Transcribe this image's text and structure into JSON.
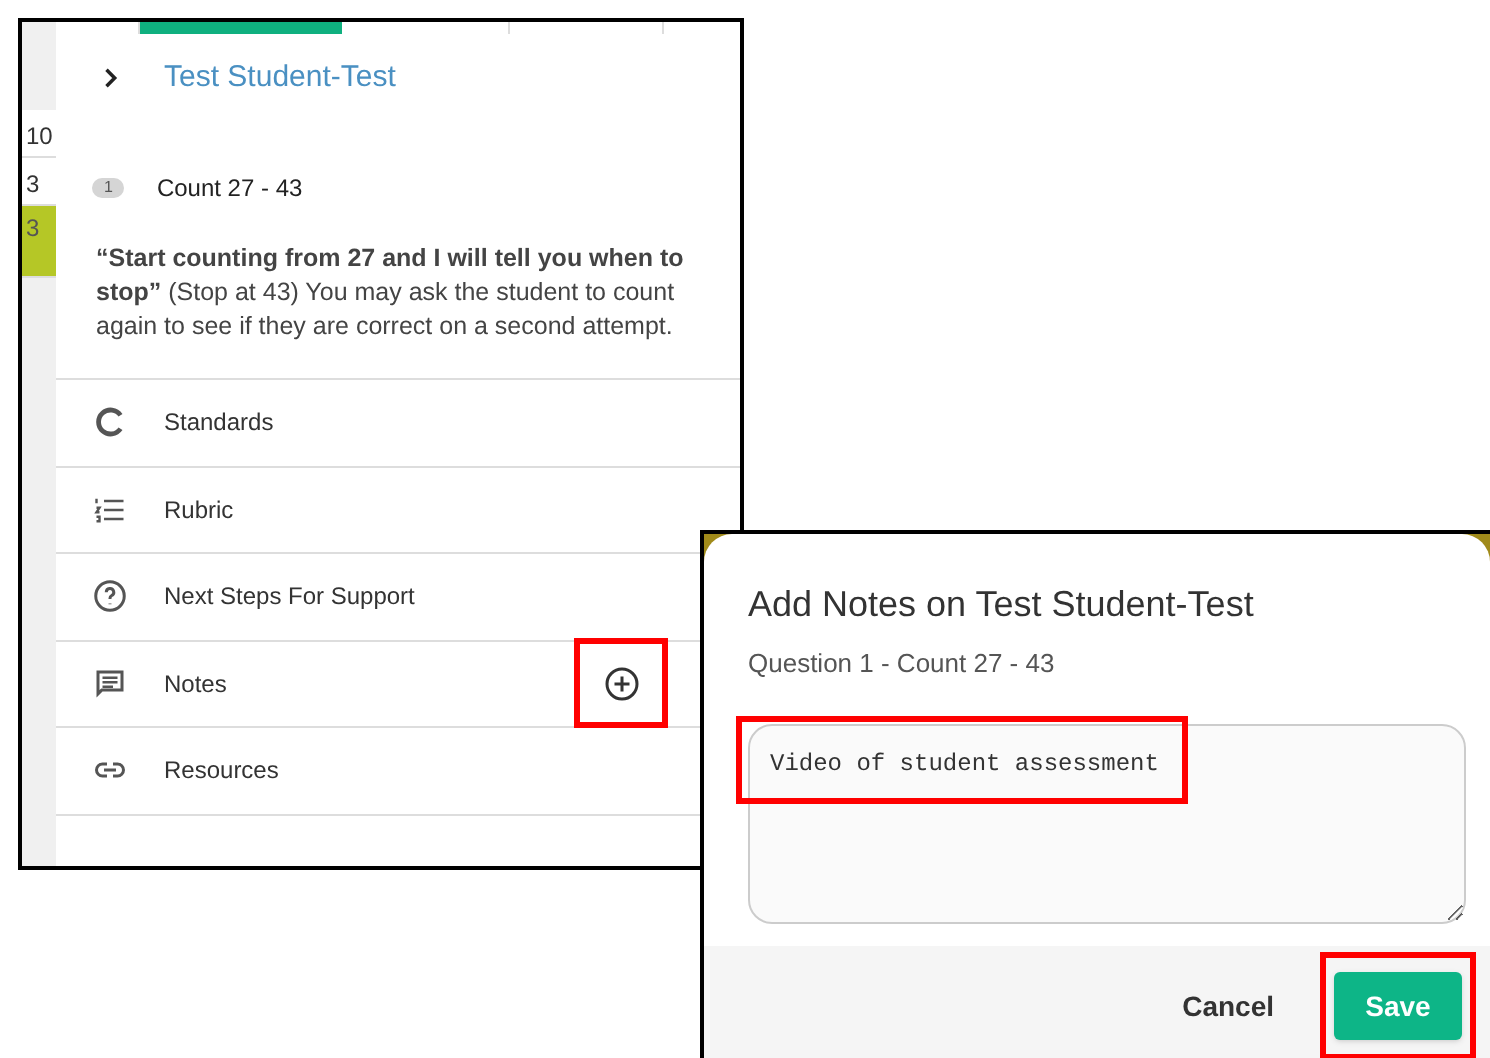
{
  "panel": {
    "grid_cells": [
      {
        "text": "10",
        "selected": false
      },
      {
        "text": "3",
        "selected": false
      },
      {
        "text": "3",
        "selected": true
      }
    ],
    "student": {
      "name": "Test Student-Test"
    },
    "question": {
      "number": "1",
      "title": "Count 27 - 43",
      "prompt": "**“Start counting from 27 and I will tell you when to stop”** (Stop at 43) You may ask the student to count again to see if they are correct on a second attempt."
    },
    "sections": [
      {
        "kind": "standards",
        "label": "Standards"
      },
      {
        "kind": "rubric",
        "label": "Rubric"
      },
      {
        "kind": "help",
        "label": "Next Steps For Support"
      },
      {
        "kind": "notes",
        "label": "Notes",
        "add_button": {
          "highlighted": true
        }
      },
      {
        "kind": "resources",
        "label": "Resources"
      }
    ]
  },
  "dialog": {
    "title": "Add Notes on Test Student-Test",
    "subtitle": "Question 1 - Count 27 - 43",
    "notes_field": {
      "value": "Video of student assessment",
      "highlighted": true
    },
    "buttons": [
      {
        "kind": "text",
        "label": "Cancel",
        "highlighted": false
      },
      {
        "kind": "primary",
        "label": "Save",
        "highlighted": true
      }
    ]
  }
}
